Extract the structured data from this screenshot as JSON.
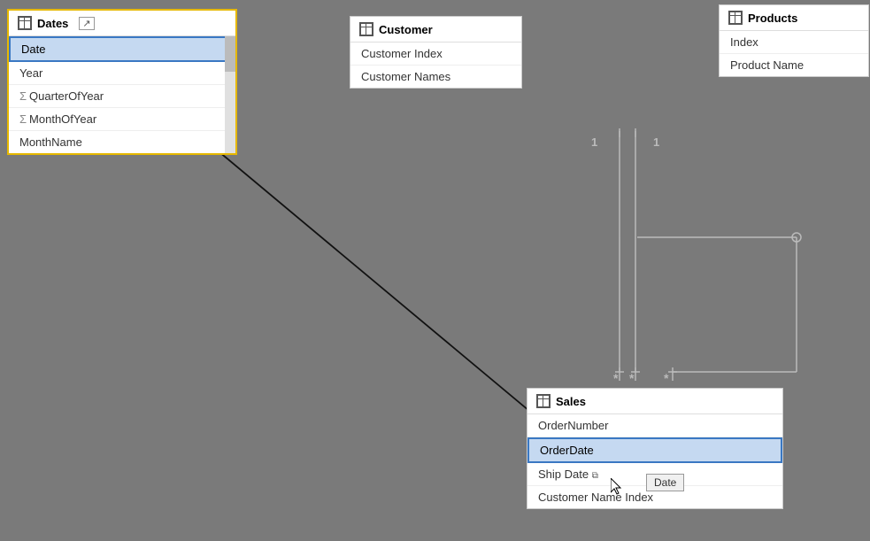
{
  "tables": {
    "dates": {
      "title": "Dates",
      "fields": [
        {
          "name": "Date",
          "type": "field",
          "selected": true
        },
        {
          "name": "Year",
          "type": "field",
          "selected": false
        },
        {
          "name": "QuarterOfYear",
          "type": "measure",
          "selected": false
        },
        {
          "name": "MonthOfYear",
          "type": "measure",
          "selected": false
        },
        {
          "name": "MonthName",
          "type": "field",
          "selected": false
        }
      ]
    },
    "customer": {
      "title": "Customer",
      "fields": [
        {
          "name": "Customer Index",
          "type": "field",
          "selected": false
        },
        {
          "name": "Customer Names",
          "type": "field",
          "selected": false
        }
      ]
    },
    "products": {
      "title": "Products",
      "fields": [
        {
          "name": "Index",
          "type": "field",
          "selected": false
        },
        {
          "name": "Product Name",
          "type": "field",
          "selected": false
        }
      ]
    },
    "sales": {
      "title": "Sales",
      "fields": [
        {
          "name": "OrderNumber",
          "type": "field",
          "selected": false
        },
        {
          "name": "OrderDate",
          "type": "field",
          "selected": true
        },
        {
          "name": "Ship Date",
          "type": "field",
          "selected": false
        },
        {
          "name": "Customer Name Index",
          "type": "field",
          "selected": false
        }
      ]
    }
  },
  "tooltip": {
    "text": "Date"
  },
  "relationship_labels": {
    "one1": "1",
    "one2": "1",
    "many1": "*",
    "many2": "*",
    "many3": "*"
  }
}
